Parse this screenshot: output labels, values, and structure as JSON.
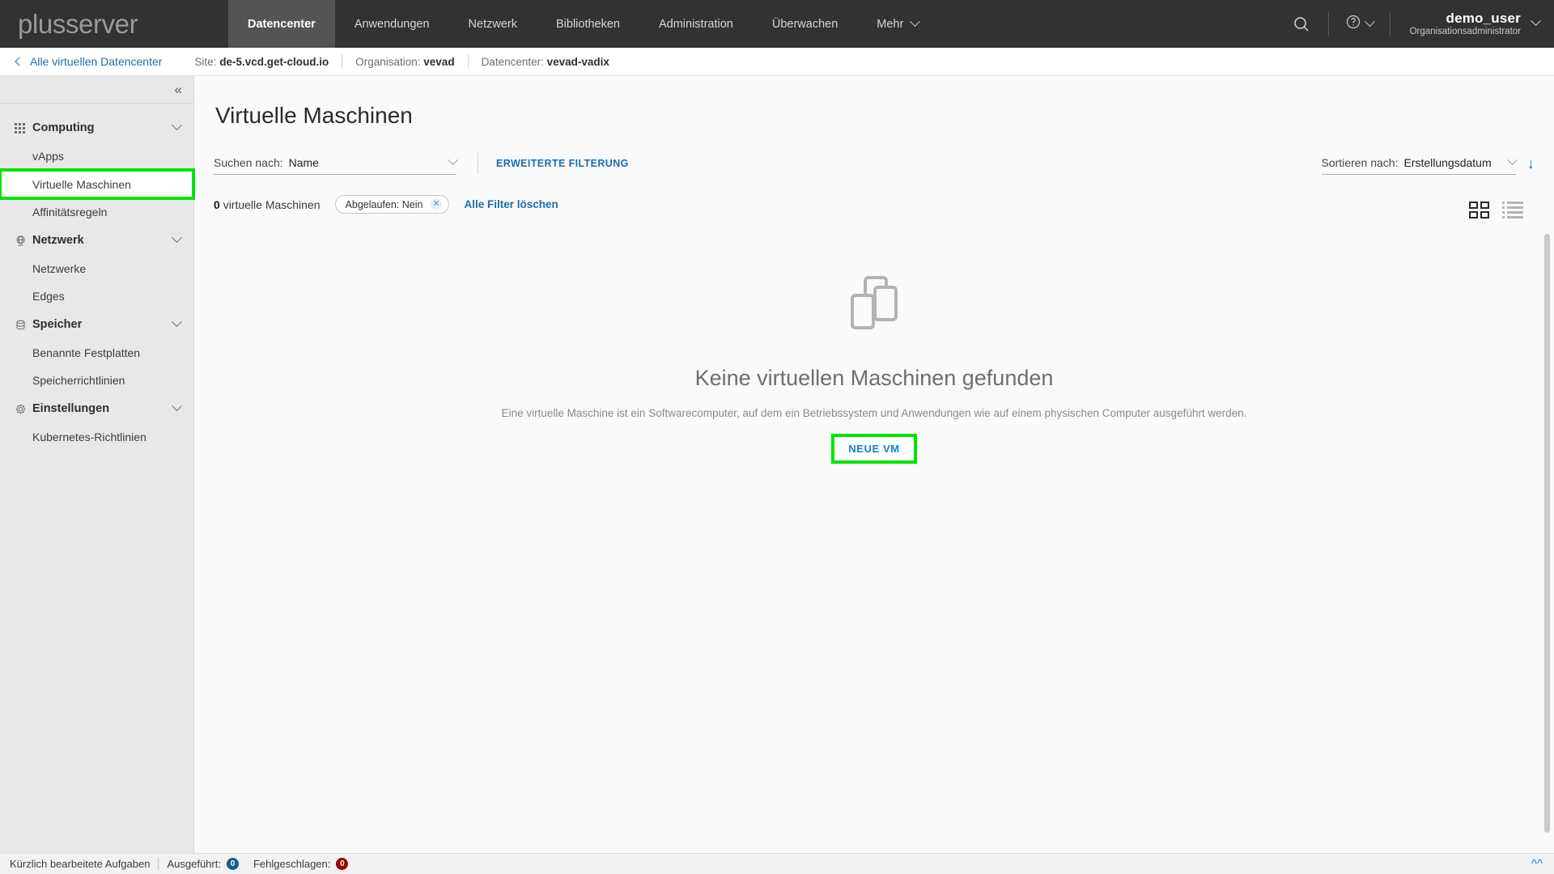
{
  "topnav": {
    "brand": "plusserver",
    "items": [
      {
        "label": "Datencenter",
        "active": true
      },
      {
        "label": "Anwendungen",
        "active": false
      },
      {
        "label": "Netzwerk",
        "active": false
      },
      {
        "label": "Bibliotheken",
        "active": false
      },
      {
        "label": "Administration",
        "active": false
      },
      {
        "label": "Überwachen",
        "active": false
      },
      {
        "label": "Mehr",
        "active": false
      }
    ],
    "search_icon": "search-icon",
    "help_icon": "help-circle-icon",
    "user": {
      "name": "demo_user",
      "role": "Organisationsadministrator"
    }
  },
  "breadcrumb": {
    "back_label": "Alle virtuellen Datencenter",
    "items": [
      {
        "label": "Site:",
        "value": "de-5.vcd.get-cloud.io"
      },
      {
        "label": "Organisation:",
        "value": "vevad"
      },
      {
        "label": "Datencenter:",
        "value": "vevad-vadix"
      }
    ]
  },
  "sidebar": {
    "collapse_label": "«",
    "sections": [
      {
        "group": "Computing",
        "icon": "apps-grid-icon",
        "items": [
          {
            "label": "vApps",
            "selected": false
          },
          {
            "label": "Virtuelle Maschinen",
            "selected": true
          },
          {
            "label": "Affinitätsregeln",
            "selected": false
          }
        ]
      },
      {
        "group": "Netzwerk",
        "icon": "network-globe-icon",
        "items": [
          {
            "label": "Netzwerke",
            "selected": false
          },
          {
            "label": "Edges",
            "selected": false
          }
        ]
      },
      {
        "group": "Speicher",
        "icon": "database-icon",
        "items": [
          {
            "label": "Benannte Festplatten",
            "selected": false
          },
          {
            "label": "Speicherrichtlinien",
            "selected": false
          }
        ]
      },
      {
        "group": "Einstellungen",
        "icon": "gear-icon",
        "items": [
          {
            "label": "Kubernetes-Richtlinien",
            "selected": false
          }
        ]
      }
    ]
  },
  "main": {
    "page_title": "Virtuelle Maschinen",
    "view_toggle": {
      "grid_icon": "grid-view-icon",
      "list_icon": "list-view-icon",
      "active": "grid"
    },
    "search": {
      "label": "Suchen nach:",
      "value": "Name"
    },
    "advanced_filter_label": "ERWEITERTE FILTERUNG",
    "sort": {
      "label": "Sortieren nach:",
      "value": "Erstellungsdatum",
      "direction_icon": "arrow-down-icon"
    },
    "count_number": "0",
    "count_label": "virtuelle Maschinen",
    "chips": [
      {
        "label": "Abgelaufen: Nein",
        "remove_icon": "close-icon"
      }
    ],
    "clear_filters_label": "Alle Filter löschen",
    "empty_state": {
      "icon": "vm-stack-icon",
      "title": "Keine virtuellen Maschinen gefunden",
      "subtitle": "Eine virtuelle Maschine ist ein Softwarecomputer, auf dem ein Betriebssystem und Anwendungen wie auf einem physischen Computer ausgeführt werden.",
      "button_label": "NEUE VM"
    }
  },
  "statusbar": {
    "tasks_label": "Kürzlich bearbeitete Aufgaben",
    "running_label": "Ausgeführt:",
    "running_count": "0",
    "failed_label": "Fehlgeschlagen:",
    "failed_count": "0",
    "expand_icon": "double-chevron-up-icon"
  },
  "colors": {
    "nav_bg": "#323232",
    "nav_active_bg": "#545454",
    "link_blue": "#1a6fa8",
    "highlight_green": "#00e500",
    "badge_blue": "#10618f",
    "badge_red": "#a00000"
  }
}
